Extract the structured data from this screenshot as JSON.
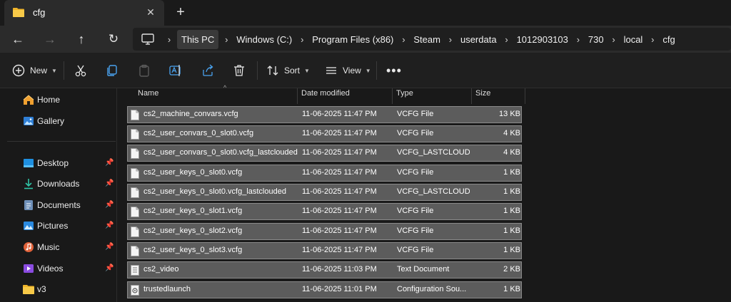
{
  "window": {
    "tab_title": "cfg"
  },
  "address": {
    "crumbs": [
      "This PC",
      "Windows (C:)",
      "Program Files (x86)",
      "Steam",
      "userdata",
      "1012903103",
      "730",
      "local",
      "cfg"
    ]
  },
  "toolbar": {
    "new_label": "New",
    "sort_label": "Sort",
    "view_label": "View"
  },
  "sidebar": {
    "items": [
      {
        "label": "Home",
        "icon": "home-icon"
      },
      {
        "label": "Gallery",
        "icon": "gallery-icon"
      },
      {
        "label": "Desktop",
        "icon": "desktop-icon"
      },
      {
        "label": "Downloads",
        "icon": "download-icon"
      },
      {
        "label": "Documents",
        "icon": "document-icon"
      },
      {
        "label": "Pictures",
        "icon": "pictures-icon"
      },
      {
        "label": "Music",
        "icon": "music-icon"
      },
      {
        "label": "Videos",
        "icon": "video-icon"
      },
      {
        "label": "v3",
        "icon": "folder-icon"
      }
    ]
  },
  "columns": {
    "name": "Name",
    "date": "Date modified",
    "type": "Type",
    "size": "Size"
  },
  "files": [
    {
      "name": "cs2_machine_convars.vcfg",
      "date": "11-06-2025 11:47 PM",
      "type": "VCFG File",
      "size": "13 KB"
    },
    {
      "name": "cs2_user_convars_0_slot0.vcfg",
      "date": "11-06-2025 11:47 PM",
      "type": "VCFG File",
      "size": "4 KB"
    },
    {
      "name": "cs2_user_convars_0_slot0.vcfg_lastclouded",
      "date": "11-06-2025 11:47 PM",
      "type": "VCFG_LASTCLOUD...",
      "size": "4 KB"
    },
    {
      "name": "cs2_user_keys_0_slot0.vcfg",
      "date": "11-06-2025 11:47 PM",
      "type": "VCFG File",
      "size": "1 KB"
    },
    {
      "name": "cs2_user_keys_0_slot0.vcfg_lastclouded",
      "date": "11-06-2025 11:47 PM",
      "type": "VCFG_LASTCLOUD...",
      "size": "1 KB"
    },
    {
      "name": "cs2_user_keys_0_slot1.vcfg",
      "date": "11-06-2025 11:47 PM",
      "type": "VCFG File",
      "size": "1 KB"
    },
    {
      "name": "cs2_user_keys_0_slot2.vcfg",
      "date": "11-06-2025 11:47 PM",
      "type": "VCFG File",
      "size": "1 KB"
    },
    {
      "name": "cs2_user_keys_0_slot3.vcfg",
      "date": "11-06-2025 11:47 PM",
      "type": "VCFG File",
      "size": "1 KB"
    },
    {
      "name": "cs2_video",
      "date": "11-06-2025 11:03 PM",
      "type": "Text Document",
      "size": "2 KB"
    },
    {
      "name": "trustedlaunch",
      "date": "11-06-2025 11:01 PM",
      "type": "Configuration Sou...",
      "size": "1 KB"
    }
  ]
}
